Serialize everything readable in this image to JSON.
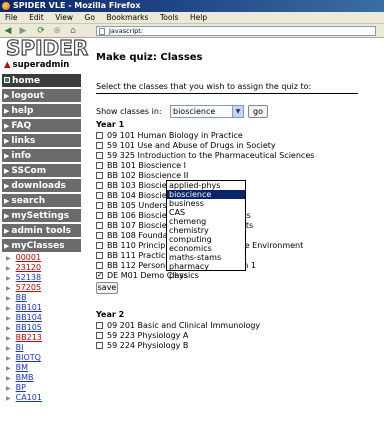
{
  "window": {
    "title": "SPIDER VLE - Mozilla Firefox"
  },
  "menubar": [
    "File",
    "Edit",
    "View",
    "Go",
    "Bookmarks",
    "Tools",
    "Help"
  ],
  "address": {
    "value": "Javascript:"
  },
  "sidebar": {
    "logo": "SPIDER",
    "user": "superadmin",
    "nav": [
      {
        "label": "home"
      },
      {
        "label": "logout"
      },
      {
        "label": "help"
      },
      {
        "label": "FAQ"
      },
      {
        "label": "links"
      },
      {
        "label": "info"
      },
      {
        "label": "SSCom"
      },
      {
        "label": "downloads"
      },
      {
        "label": "search"
      },
      {
        "label": "mySettings"
      },
      {
        "label": "admin tools"
      },
      {
        "label": "myClasses"
      }
    ],
    "classes": [
      "00001",
      "23120",
      "52138",
      "57205",
      "BB",
      "BB101",
      "BB104",
      "BB105",
      "BB213",
      "BI",
      "BIOTQ",
      "BM",
      "BMB",
      "BP",
      "CA101"
    ]
  },
  "main": {
    "title": "Make quiz: Classes",
    "instruction": "Select the classes that you wish to assign the quiz to:",
    "show_label": "Show classes in:",
    "selected_dept": "bioscience",
    "go_label": "go",
    "year1_label": "Year 1",
    "year1_rows": [
      {
        "label": "09 101 Human Biology in Practice",
        "checked": false
      },
      {
        "label": "59 101 Use and Abuse of Drugs in Society",
        "checked": false
      },
      {
        "label": "59 325 Introduction to the Pharmaceutical Sciences",
        "checked": false
      },
      {
        "label": "BB 101 Bioscience I",
        "checked": false
      },
      {
        "label": "BB 102 Bioscience II",
        "checked": false
      },
      {
        "label": "BB 103 Bioscience III",
        "checked": false
      },
      {
        "label": "BB 104 Bioscience IV",
        "checked": false
      },
      {
        "label": "BB 105 Understanding Bioscience",
        "checked": false
      },
      {
        "label": "BB 106 Bioscience I for Pharmacists",
        "checked": false
      },
      {
        "label": "BB 107 Bioscience II for Pharmacists",
        "checked": false
      },
      {
        "label": "BB 108 Foundation Bioscience",
        "checked": false
      },
      {
        "label": "BB 110 Principles of Science for the Environment",
        "checked": false
      },
      {
        "label": "BB 111 Practical Bioscience 1",
        "checked": false
      },
      {
        "label": "BB 112 Personal Development Plan 1",
        "checked": false
      },
      {
        "label": "DE M01 Demo Class",
        "checked": true
      }
    ],
    "save_label": "save",
    "year2_label": "Year 2",
    "year2_rows": [
      {
        "label": "09 201 Basic and Clinical Immunology",
        "checked": false
      },
      {
        "label": "59 223 Physiology A",
        "checked": false
      },
      {
        "label": "59 224 Physiology B",
        "checked": false
      }
    ]
  },
  "dropdown_options": [
    "applied-phys",
    "bioscience",
    "business",
    "CAS",
    "chemeng",
    "chemistry",
    "computing",
    "economics",
    "maths-stams",
    "pharmacy",
    "physics"
  ],
  "colors": {
    "nav_bg": "#6b6b6b",
    "selection": "#0a246a",
    "link": "#1a33cc",
    "visited_link": "#cc0000"
  }
}
